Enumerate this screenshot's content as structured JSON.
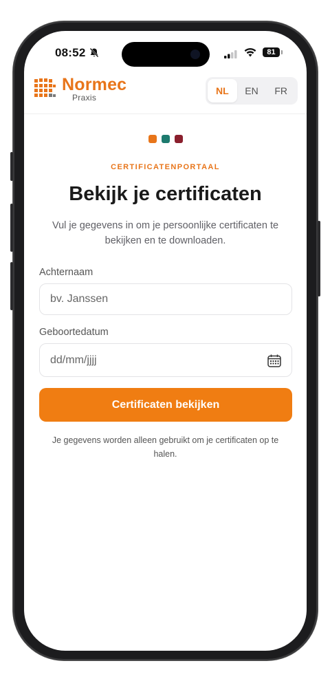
{
  "status_bar": {
    "time": "08:52",
    "battery": "81"
  },
  "header": {
    "brand_name": "Normec",
    "brand_sub": "Praxis",
    "languages": [
      {
        "code": "NL",
        "active": true
      },
      {
        "code": "EN",
        "active": false
      },
      {
        "code": "FR",
        "active": false
      }
    ]
  },
  "hero": {
    "dots": [
      "#e8751a",
      "#1d7a6e",
      "#8a1f2d"
    ],
    "eyebrow": "CERTIFICATENPORTAAL",
    "title": "Bekijk je certificaten",
    "subtitle": "Vul je gegevens in om je persoonlijke certificaten te bekijken en te downloaden."
  },
  "form": {
    "lastname_label": "Achternaam",
    "lastname_placeholder": "bv. Janssen",
    "birthdate_label": "Geboortedatum",
    "birthdate_placeholder": "dd/mm/jjjj",
    "submit_label": "Certificaten bekijken",
    "footnote": "Je gegevens worden alleen gebruikt om je certificaten op te halen."
  },
  "colors": {
    "accent": "#f07d12",
    "brand": "#e8751a"
  },
  "icons": [
    "bell-slash-icon",
    "signal-icon",
    "wifi-icon",
    "battery-icon",
    "calendar-icon"
  ]
}
